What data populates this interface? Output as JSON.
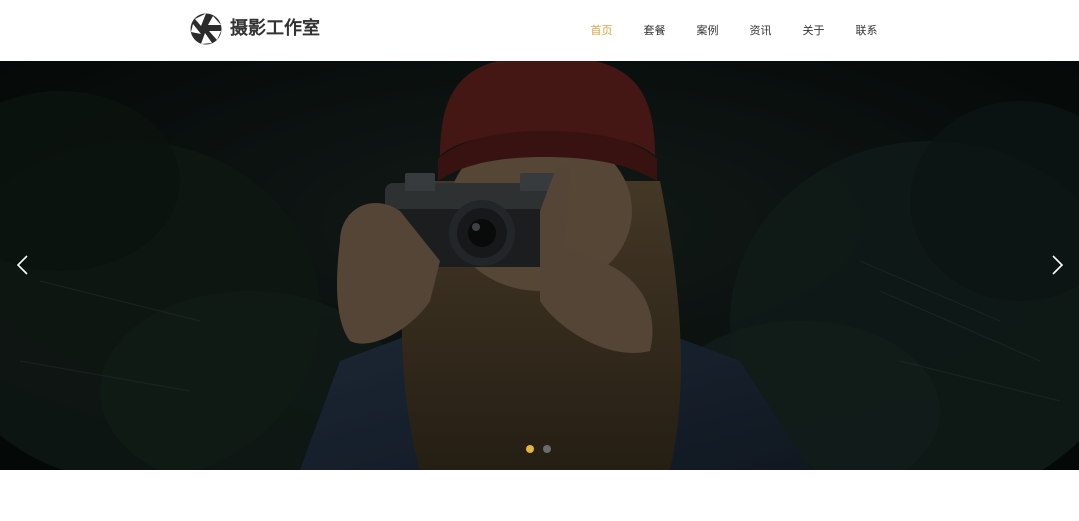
{
  "header": {
    "logo_text": "摄影工作室",
    "nav": [
      {
        "label": "首页",
        "active": true
      },
      {
        "label": "套餐",
        "active": false
      },
      {
        "label": "案例",
        "active": false
      },
      {
        "label": "资讯",
        "active": false
      },
      {
        "label": "关于",
        "active": false
      },
      {
        "label": "联系",
        "active": false
      }
    ]
  },
  "banner": {
    "image": "photo-woman-red-beanie-holding-vintage-camera",
    "prev_icon": "chevron-left-icon",
    "next_icon": "chevron-right-icon",
    "slides_total": 2,
    "active_slide": 1
  },
  "colors": {
    "accent": "#d6a648",
    "dot_active": "#e4b43e",
    "dot_inactive": "#6b6b6b",
    "nav_text": "#333333"
  }
}
